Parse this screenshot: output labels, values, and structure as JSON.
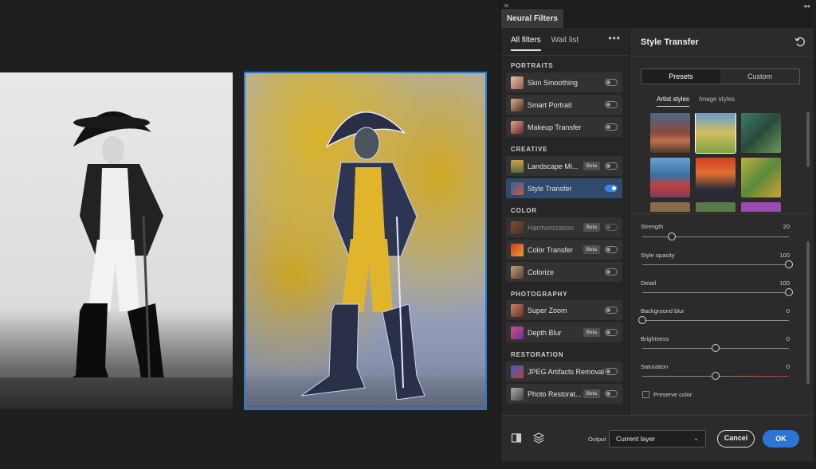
{
  "panel": {
    "title": "Neural Filters",
    "filter_tabs": [
      "All filters",
      "Wait list"
    ],
    "more_label": "•••"
  },
  "sections": {
    "portraits": "PORTRAITS",
    "creative": "CREATIVE",
    "color": "COLOR",
    "photography": "PHOTOGRAPHY",
    "restoration": "RESTORATION"
  },
  "filters": [
    {
      "label": "Skin Smoothing",
      "beta": "",
      "on": false
    },
    {
      "label": "Smart Portrait",
      "beta": "",
      "on": false
    },
    {
      "label": "Makeup Transfer",
      "beta": "",
      "on": false
    },
    {
      "label": "Landscape Mi...",
      "beta": "Beta",
      "on": false
    },
    {
      "label": "Style Transfer",
      "beta": "",
      "on": true
    },
    {
      "label": "Harmonization",
      "beta": "Beta",
      "on": false
    },
    {
      "label": "Color Transfer",
      "beta": "Beta",
      "on": false
    },
    {
      "label": "Colorize",
      "beta": "",
      "on": false
    },
    {
      "label": "Super Zoom",
      "beta": "",
      "on": false
    },
    {
      "label": "Depth Blur",
      "beta": "Beta",
      "on": false
    },
    {
      "label": "JPEG Artifacts Removal",
      "beta": "",
      "on": false
    },
    {
      "label": "Photo Restorat...",
      "beta": "Beta",
      "on": false
    }
  ],
  "detail": {
    "title": "Style Transfer",
    "segments": [
      "Presets",
      "Custom"
    ],
    "style_tabs": [
      "Artist styles",
      "Image styles"
    ],
    "sliders": [
      {
        "label": "Strength",
        "value": "20",
        "fraction": 0.2
      },
      {
        "label": "Style opacity",
        "value": "100",
        "fraction": 1.0
      },
      {
        "label": "Detail",
        "value": "100",
        "fraction": 1.0
      },
      {
        "label": "Background blur",
        "value": "0",
        "fraction": 0.0
      },
      {
        "label": "Brightness",
        "value": "0",
        "fraction": 0.5
      },
      {
        "label": "Saturation",
        "value": "0",
        "fraction": 0.5
      }
    ],
    "preserve_color": "Preserve color"
  },
  "footer": {
    "output_label": "Output",
    "output_value": "Current layer",
    "cancel": "Cancel",
    "ok": "OK"
  },
  "colors": {
    "accent": "#2d75d4",
    "selected_row": "#2f4a6c",
    "saturation_track": "#c0393b"
  }
}
